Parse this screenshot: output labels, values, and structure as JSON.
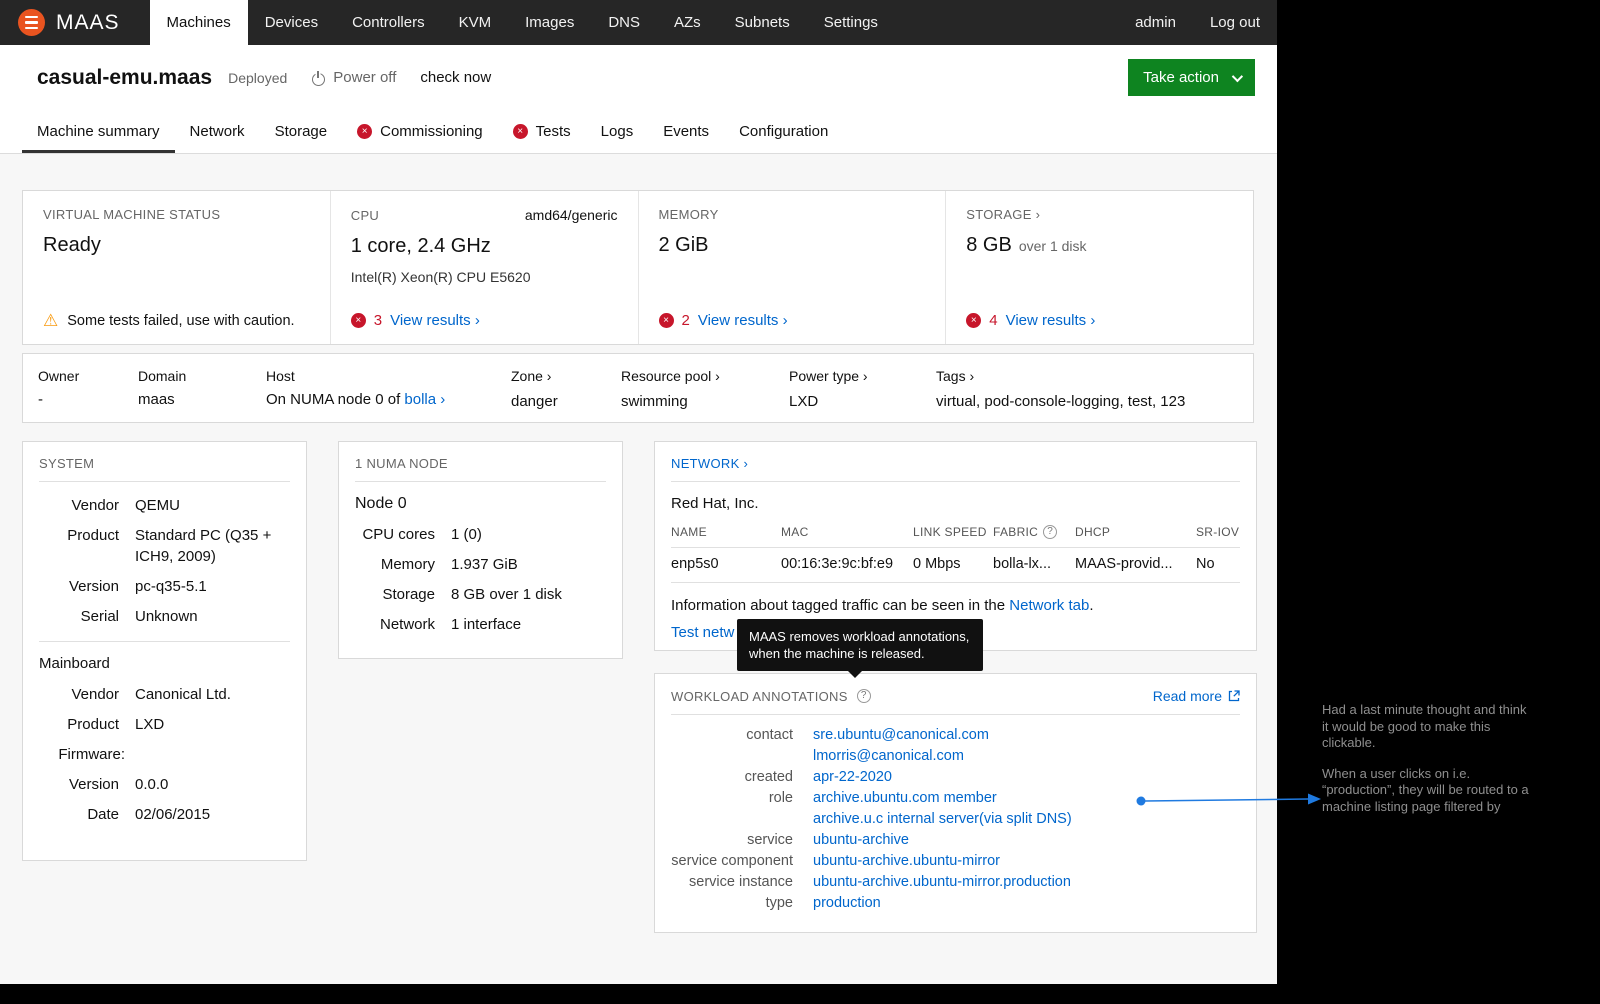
{
  "icons": {
    "close_glyph": "×",
    "warning_glyph": "⚠",
    "help_glyph": "?"
  },
  "colors": {
    "brand_orange": "#e95420",
    "accent_green": "#0e8420",
    "link_blue": "#0066cc",
    "error_red": "#c7162b",
    "warning_orange": "#f99b11"
  },
  "nav": {
    "brand": "MAAS",
    "items": [
      {
        "label": "Machines",
        "active": true
      },
      {
        "label": "Devices"
      },
      {
        "label": "Controllers"
      },
      {
        "label": "KVM"
      },
      {
        "label": "Images"
      },
      {
        "label": "DNS"
      },
      {
        "label": "AZs"
      },
      {
        "label": "Subnets"
      },
      {
        "label": "Settings"
      }
    ],
    "admin": "admin",
    "logout": "Log out"
  },
  "header": {
    "title": "casual-emu.maas",
    "status": "Deployed",
    "power_label": "Power off",
    "check_label": "check now",
    "action_label": "Take action"
  },
  "tabs": [
    {
      "label": "Machine summary",
      "active": true
    },
    {
      "label": "Network"
    },
    {
      "label": "Storage"
    },
    {
      "label": "Commissioning",
      "error": true
    },
    {
      "label": "Tests",
      "error": true
    },
    {
      "label": "Logs"
    },
    {
      "label": "Events"
    },
    {
      "label": "Configuration"
    }
  ],
  "overview": {
    "status": {
      "label": "VIRTUAL MACHINE STATUS",
      "value": "Ready",
      "warning": "Some tests failed, use with caution."
    },
    "cpu": {
      "label": "CPU",
      "arch": "amd64/generic",
      "value": "1 core, 2.4 GHz",
      "model": "Intel(R) Xeon(R) CPU E5620",
      "error_count": "3",
      "results_link": "View results ›"
    },
    "memory": {
      "label": "MEMORY",
      "value": "2 GiB",
      "error_count": "2",
      "results_link": "View results ›"
    },
    "storage": {
      "label": "STORAGE ›",
      "value": "8 GB",
      "suffix": "over 1 disk",
      "error_count": "4",
      "results_link": "View results ›"
    }
  },
  "meta": {
    "owner": {
      "label": "Owner",
      "value": "-"
    },
    "domain": {
      "label": "Domain",
      "value": "maas"
    },
    "host": {
      "label": "Host",
      "prefix": "On NUMA node 0 of ",
      "link": "bolla ›"
    },
    "zone": {
      "label": "Zone ›",
      "value": "danger"
    },
    "pool": {
      "label": "Resource pool ›",
      "value": "swimming"
    },
    "power": {
      "label": "Power type ›",
      "value": "LXD"
    },
    "tags": {
      "label": "Tags ›",
      "value": "virtual, pod-console-logging, test, 123"
    }
  },
  "system": {
    "title": "SYSTEM",
    "rows": [
      {
        "label": "Vendor",
        "value": "QEMU"
      },
      {
        "label": "Product",
        "value": "Standard PC (Q35 + ICH9, 2009)"
      },
      {
        "label": "Version",
        "value": "pc-q35-5.1"
      },
      {
        "label": "Serial",
        "value": "Unknown"
      }
    ],
    "mainboard_title": "Mainboard",
    "mainboard_rows": [
      {
        "label": "Vendor",
        "value": "Canonical Ltd."
      },
      {
        "label": "Product",
        "value": "LXD"
      }
    ],
    "firmware_label": "Firmware:",
    "firmware_rows": [
      {
        "label": "Version",
        "value": "0.0.0"
      },
      {
        "label": "Date",
        "value": "02/06/2015"
      }
    ]
  },
  "numa": {
    "title": "1 NUMA NODE",
    "node": "Node 0",
    "rows": [
      {
        "label": "CPU cores",
        "value": "1 (0)"
      },
      {
        "label": "Memory",
        "value": "1.937 GiB"
      },
      {
        "label": "Storage",
        "value": "8 GB over 1 disk"
      },
      {
        "label": "Network",
        "value": "1 interface"
      }
    ]
  },
  "network": {
    "title": "NETWORK ›",
    "vendor": "Red Hat, Inc.",
    "table": {
      "headers": [
        "NAME",
        "MAC",
        "LINK SPEED",
        "FABRIC",
        "DHCP",
        "SR-IOV"
      ],
      "row": [
        "enp5s0",
        "00:16:3e:9c:bf:e9",
        "0 Mbps",
        "bolla-lx...",
        "MAAS-provid...",
        "No"
      ]
    },
    "info_prefix": "Information about tagged traffic can be seen in the ",
    "info_link": "Network tab",
    "info_suffix": ".",
    "test_link": "Test netw"
  },
  "tooltip": {
    "text": "MAAS removes workload annotations, when the machine is released."
  },
  "workload": {
    "title": "WORKLOAD ANNOTATIONS",
    "read_more": "Read more",
    "rows": [
      {
        "label": "contact",
        "values": [
          "sre.ubuntu@canonical.com",
          "lmorris@canonical.com"
        ]
      },
      {
        "label": "created",
        "values": [
          "apr-22-2020"
        ]
      },
      {
        "label": "role",
        "values": [
          "archive.ubuntu.com member",
          "archive.u.c internal server(via split DNS)"
        ]
      },
      {
        "label": "service",
        "values": [
          "ubuntu-archive"
        ]
      },
      {
        "label": "service component",
        "values": [
          "ubuntu-archive.ubuntu-mirror"
        ]
      },
      {
        "label": "service instance",
        "values": [
          "ubuntu-archive.ubuntu-mirror.production"
        ]
      },
      {
        "label": "type",
        "values": [
          "production"
        ]
      }
    ]
  },
  "annotation": {
    "note1": "Had a last minute thought and think it would be good to make this clickable.",
    "note2": "When a user clicks on i.e. “production”, they will be routed to a machine listing page filtered by"
  }
}
